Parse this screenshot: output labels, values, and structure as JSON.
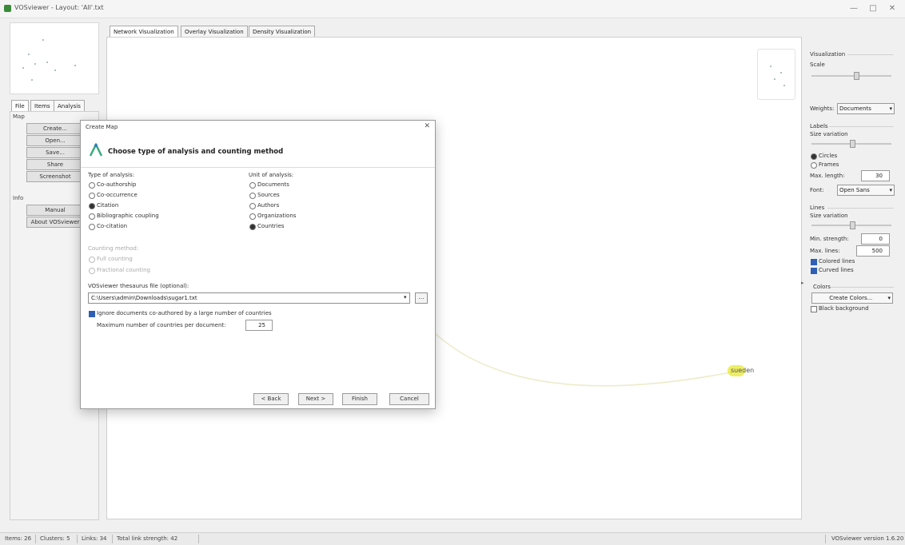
{
  "window": {
    "title": "VOSviewer - Layout: 'All'.txt"
  },
  "left_tabs": [
    "File",
    "Items",
    "Analysis"
  ],
  "left_panel": {
    "map_group": "Map",
    "buttons": [
      "Create...",
      "Open...",
      "Save...",
      "Share",
      "Screenshot"
    ],
    "info_group": "Info",
    "info_buttons": [
      "Manual",
      "About VOSviewer"
    ]
  },
  "main_tabs": [
    "Network Visualization",
    "Overlay Visualization",
    "Density Visualization"
  ],
  "canvas": {
    "node_label": "sueden"
  },
  "right_panel": {
    "visualization": "Visualization",
    "scale": "Scale",
    "weights_label": "Weights:",
    "weights_value": "Documents",
    "labels": "Labels",
    "size_variation": "Size variation",
    "circles": "Circles",
    "frames": "Frames",
    "max_length_label": "Max. length:",
    "max_length_value": "30",
    "font_label": "Font:",
    "font_value": "Open Sans",
    "lines": "Lines",
    "lines_size_variation": "Size variation",
    "min_strength_label": "Min. strength:",
    "min_strength_value": "0",
    "max_lines_label": "Max. lines:",
    "max_lines_value": "500",
    "colored_lines": "Colored lines",
    "curved_lines": "Curved lines",
    "colors": "Colors",
    "colors_button": "Create Colors...",
    "black_background": "Black background"
  },
  "status_bar": {
    "items": "Items: 26",
    "clusters": "Clusters: 5",
    "links": "Links: 34",
    "total_link_strength": "Total link strength: 42",
    "version": "VOSviewer version 1.6.20"
  },
  "dialog": {
    "title": "Create Map",
    "heading": "Choose type of analysis and counting method",
    "type_of_analysis": "Type of analysis:",
    "analysis_options": [
      "Co-authorship",
      "Co-occurrence",
      "Citation",
      "Bibliographic coupling",
      "Co-citation"
    ],
    "analysis_selected": 2,
    "unit_of_analysis": "Unit of analysis:",
    "unit_options": [
      "Documents",
      "Sources",
      "Authors",
      "Organizations",
      "Countries"
    ],
    "unit_selected": 4,
    "counting_method": "Counting method:",
    "counting_options": [
      "Full counting",
      "Fractional counting"
    ],
    "thesaurus_label": "VOSviewer thesaurus file (optional):",
    "thesaurus_value": "C:\\Users\\admin\\Downloads\\sugar1.txt",
    "ignore_docs": "Ignore documents co-authored by a large number of countries",
    "max_countries_label": "Maximum number of countries per document:",
    "max_countries_value": "25",
    "buttons": {
      "back": "< Back",
      "next": "Next >",
      "finish": "Finish",
      "cancel": "Cancel"
    }
  },
  "colors": {
    "accent": "#2f5fb5",
    "node": "#e8e832",
    "logo": "#3aa97a"
  }
}
